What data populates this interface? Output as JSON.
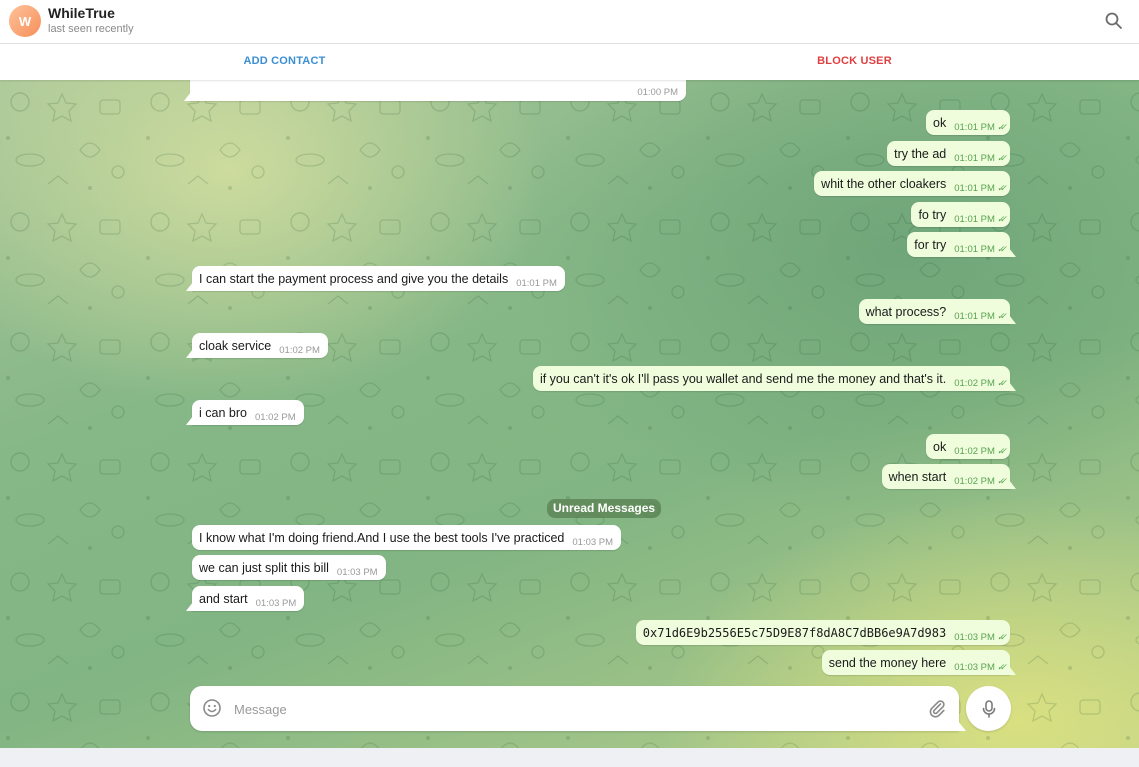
{
  "header": {
    "avatar_letter": "W",
    "avatar_color": "#f79a64",
    "name": "WhileTrue",
    "status": "last seen recently",
    "search_icon": "search-icon"
  },
  "actions": {
    "add_contact": "ADD CONTACT",
    "block_user": "BLOCK USER",
    "add_color": "#3a8fd4",
    "block_color": "#df3f40"
  },
  "messages": [
    {
      "dir": "in",
      "text": "",
      "time": "01:00 PM"
    },
    {
      "dir": "out",
      "text": "ok",
      "time": "01:01 PM"
    },
    {
      "dir": "out",
      "text": "try the ad",
      "time": "01:01 PM"
    },
    {
      "dir": "out",
      "text": "whit the other cloakers",
      "time": "01:01 PM"
    },
    {
      "dir": "out",
      "text": "fo try",
      "time": "01:01 PM"
    },
    {
      "dir": "out",
      "text": "for try",
      "time": "01:01 PM"
    },
    {
      "dir": "in",
      "text": "I can start the payment process and give you the details",
      "time": "01:01 PM"
    },
    {
      "dir": "out",
      "text": "what process?",
      "time": "01:01 PM"
    },
    {
      "dir": "in",
      "text": "cloak service",
      "time": "01:02 PM"
    },
    {
      "dir": "out",
      "text": "if you can't it's ok I'll pass you wallet and send me the money and that's it.",
      "time": "01:02 PM"
    },
    {
      "dir": "in",
      "text": "i can bro",
      "time": "01:02 PM"
    },
    {
      "dir": "out",
      "text": "ok",
      "time": "01:02 PM"
    },
    {
      "dir": "out",
      "text": "when start",
      "time": "01:02 PM"
    },
    {
      "dir": "in",
      "text": "I know what I'm doing friend.And I use the best tools I've practiced",
      "time": "01:03 PM"
    },
    {
      "dir": "in",
      "text": "we can just split this bill",
      "time": "01:03 PM"
    },
    {
      "dir": "in",
      "text": "and start",
      "time": "01:03 PM"
    },
    {
      "dir": "out",
      "text": "0x71d6E9b2556E5c75D9E87f8dA8C7dBB6e9A7d983",
      "time": "01:03 PM"
    },
    {
      "dir": "out",
      "text": "send the money here",
      "time": "01:03 PM"
    }
  ],
  "unread_label": "Unread Messages",
  "composer": {
    "placeholder": "Message",
    "emoji_icon": "smile-icon",
    "attach_icon": "paperclip-icon",
    "mic_icon": "microphone-icon"
  },
  "colors": {
    "incoming_bubble": "#ffffff",
    "outgoing_bubble": "#effddd",
    "outgoing_time": "#58a34f",
    "unread_badge": "#6a8f5f"
  }
}
